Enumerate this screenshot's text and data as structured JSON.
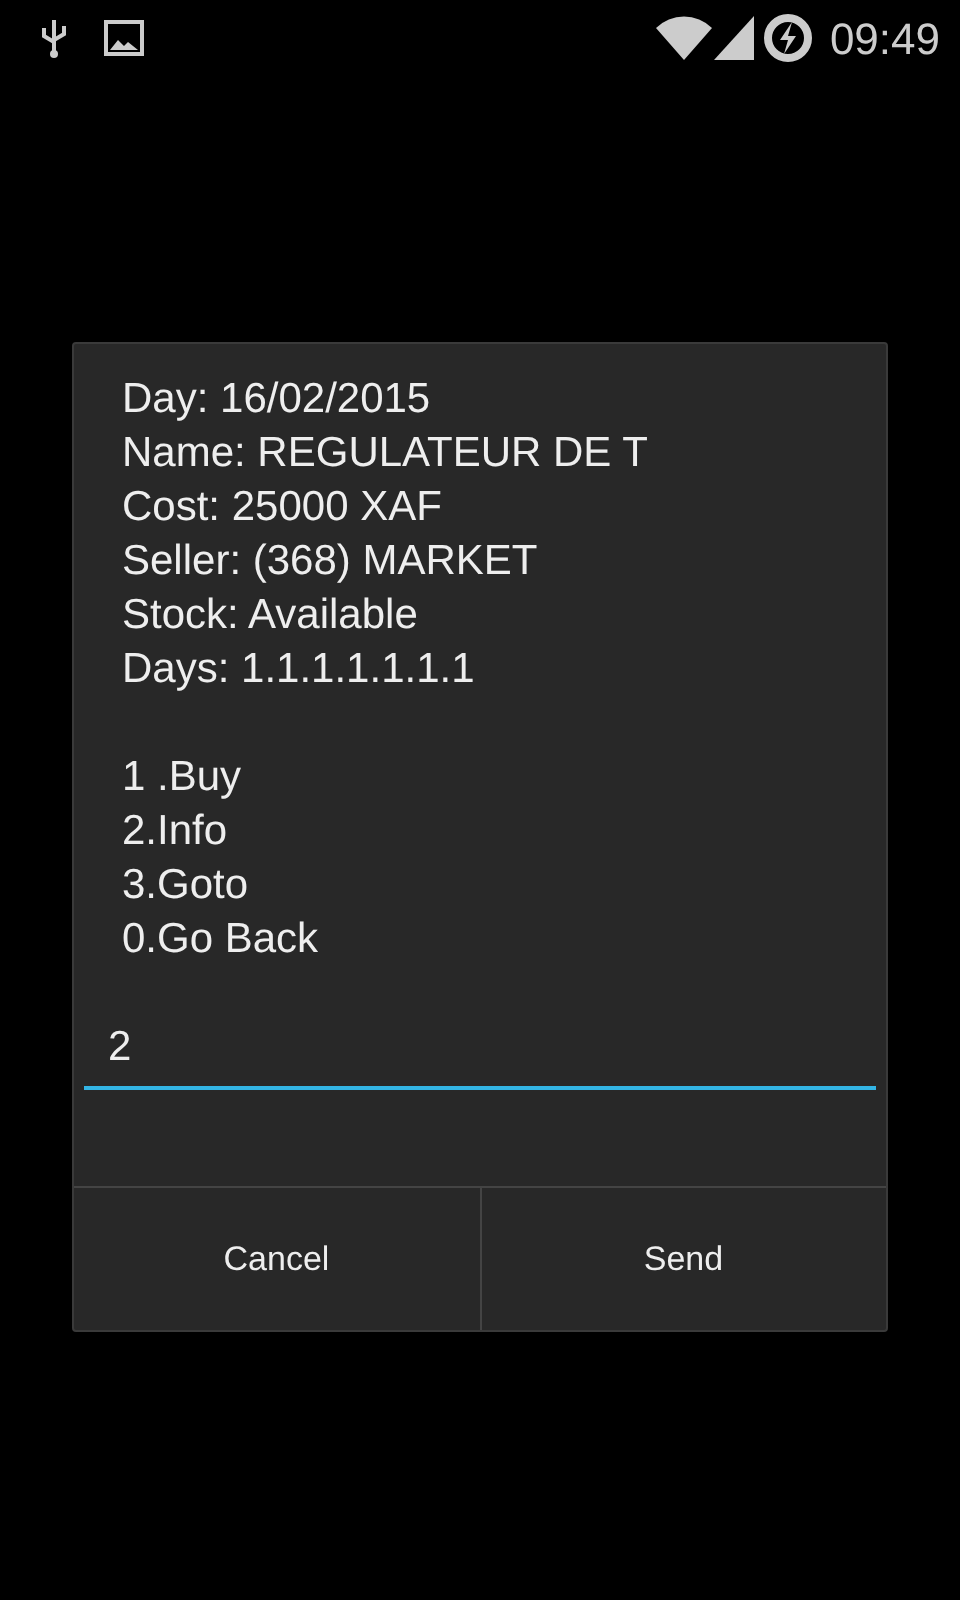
{
  "status_bar": {
    "time": "09:49"
  },
  "dialog": {
    "message_lines": [
      "Day: 16/02/2015",
      "Name: REGULATEUR DE T",
      "Cost: 25000 XAF",
      "Seller: (368) MARKET",
      "Stock: Available",
      "Days: 1.1.1.1.1.1.1"
    ],
    "menu_lines": [
      "1 .Buy",
      "2.Info",
      "3.Goto",
      "0.Go Back"
    ],
    "input": {
      "value": "2",
      "focused": true
    },
    "buttons": [
      "Cancel",
      "Send"
    ]
  }
}
